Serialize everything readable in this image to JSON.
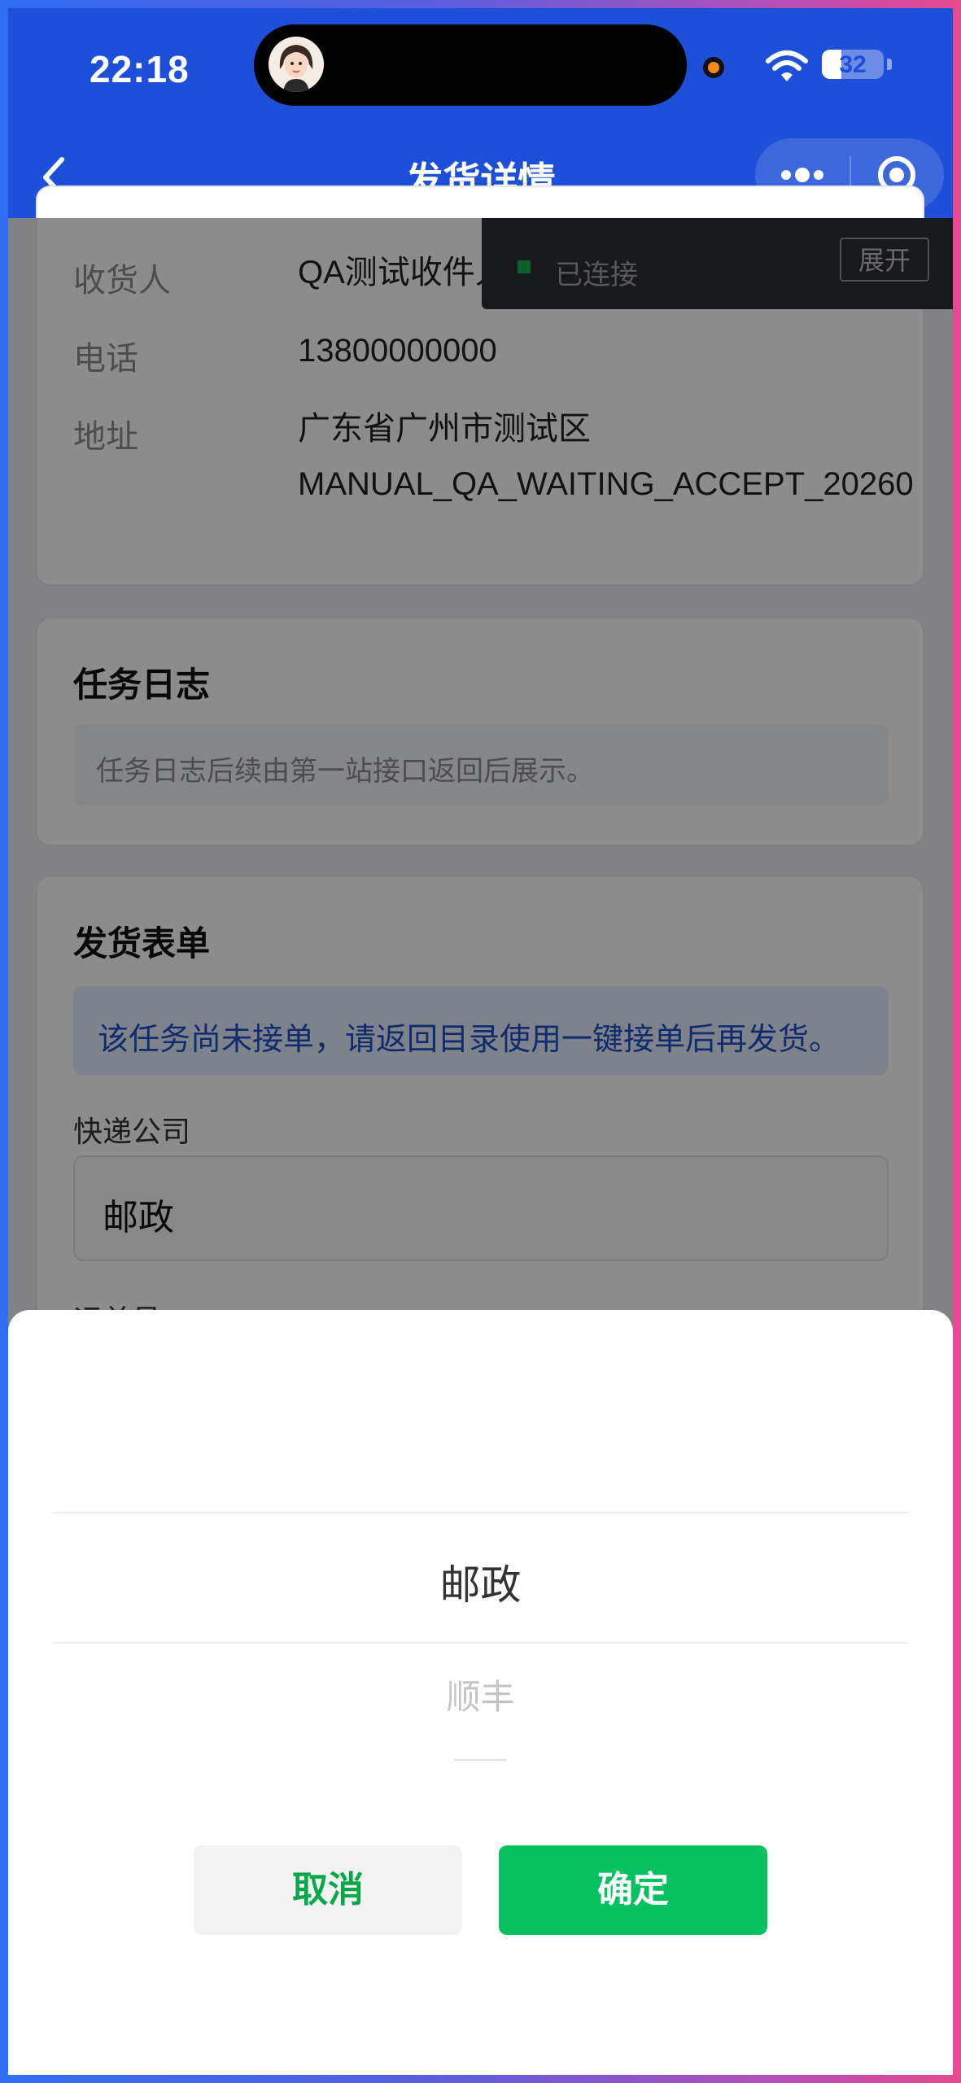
{
  "status_bar": {
    "time": "22:18",
    "battery": "32",
    "battery_level": 0.32
  },
  "nav": {
    "title": "发货详情"
  },
  "connection": {
    "status": "已连接",
    "expand_label": "展开"
  },
  "receiver_card": {
    "rows": [
      {
        "label": "收货人",
        "value": "QA测试收件人"
      },
      {
        "label": "电话",
        "value": "13800000000"
      },
      {
        "label": "地址",
        "value_line1": "广东省广州市测试区",
        "value_line2": "MANUAL_QA_WAITING_ACCEPT_20260"
      }
    ]
  },
  "task_log": {
    "title": "任务日志",
    "text": "任务日志后续由第一站接口返回后展示。"
  },
  "shipping_form": {
    "title": "发货表单",
    "notice": "该任务尚未接单，请返回目录使用一键接单后再发货。",
    "courier_label": "快递公司",
    "courier_value": "邮政",
    "tracking_label": "运单号"
  },
  "picker": {
    "selected": "邮政",
    "next": "顺丰",
    "cancel_label": "取消",
    "confirm_label": "确定"
  },
  "colors": {
    "nav_blue": "#1e4fd8",
    "confirm_green": "#07c160",
    "connected_green": "#16b04b"
  }
}
